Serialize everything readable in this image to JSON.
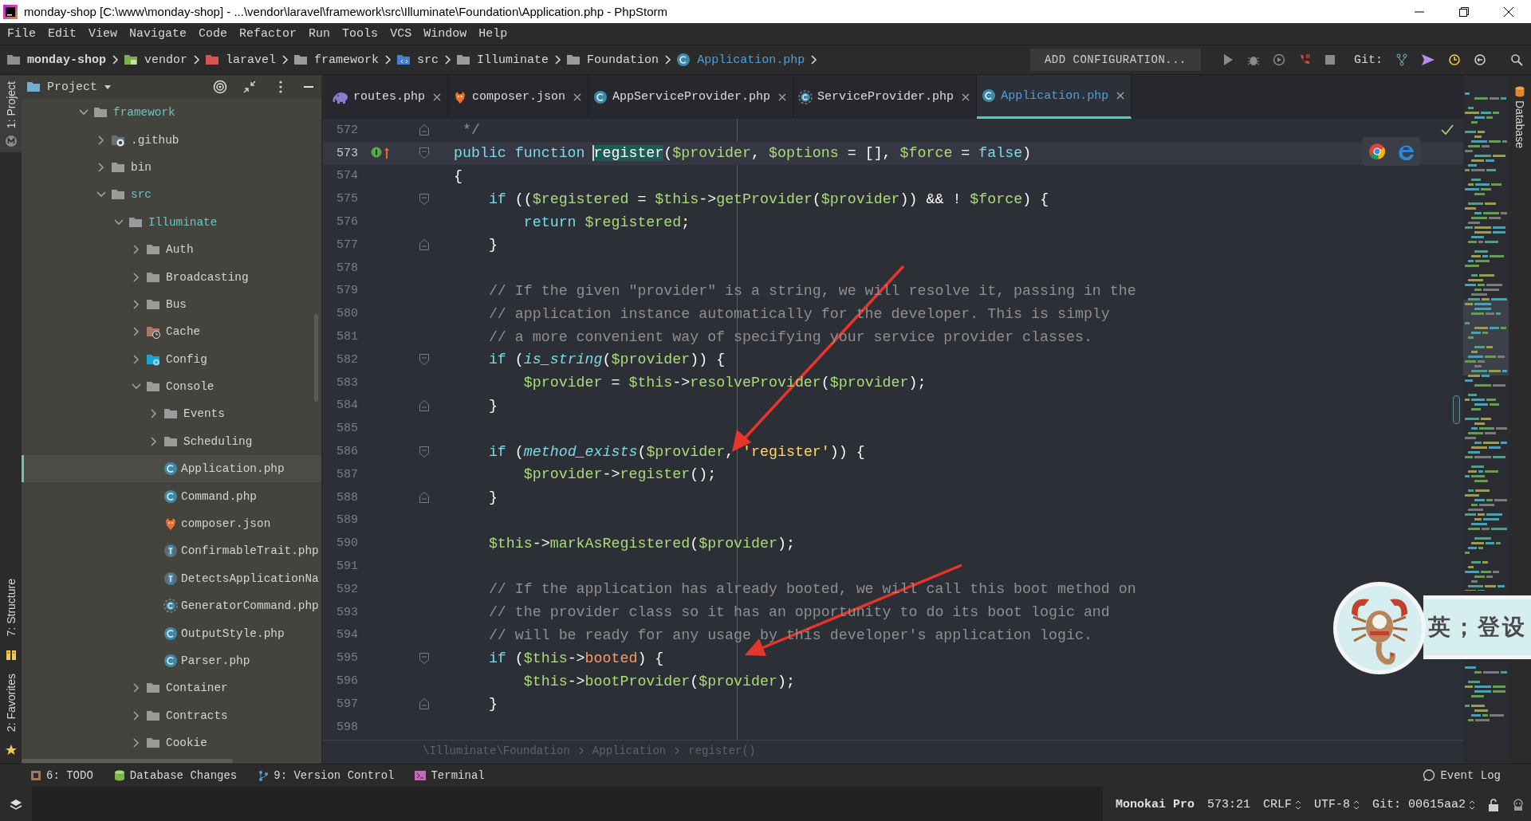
{
  "window": {
    "title": "monday-shop [C:\\www\\monday-shop] - ...\\vendor\\laravel\\framework\\src\\Illuminate\\Foundation\\Application.php - PhpStorm"
  },
  "menu": [
    "File",
    "Edit",
    "View",
    "Navigate",
    "Code",
    "Refactor",
    "Run",
    "Tools",
    "VCS",
    "Window",
    "Help"
  ],
  "navigation": {
    "path": [
      {
        "label": "monday-shop",
        "kind": "project"
      },
      {
        "label": "vendor",
        "kind": "vendor"
      },
      {
        "label": "laravel",
        "kind": "excluded"
      },
      {
        "label": "framework",
        "kind": "folder"
      },
      {
        "label": "src",
        "kind": "source"
      },
      {
        "label": "Illuminate",
        "kind": "folder"
      },
      {
        "label": "Foundation",
        "kind": "folder"
      },
      {
        "label": "Application.php",
        "kind": "class"
      }
    ],
    "run_configuration": "ADD CONFIGURATION...",
    "git_label": "Git:"
  },
  "left_strip": {
    "top": [
      "1: Project"
    ],
    "bottom": [
      "7: Structure",
      "2: Favorites"
    ]
  },
  "right_strip": [
    "Database"
  ],
  "project_panel": {
    "title": "Project",
    "tree": [
      {
        "label": "framework",
        "kind": "folder",
        "expanded": true,
        "selected": false,
        "color": "#6dc5c2",
        "children": [
          {
            "label": ".github",
            "kind": "github",
            "expanded": false,
            "selected": false,
            "color": "#d4d4d4"
          },
          {
            "label": "bin",
            "kind": "folder",
            "expanded": false,
            "selected": false,
            "color": "#d4d4d4"
          },
          {
            "label": "src",
            "kind": "folder",
            "expanded": true,
            "selected": false,
            "color": "#6dc5c2",
            "children": [
              {
                "label": "Illuminate",
                "kind": "folder",
                "expanded": true,
                "selected": false,
                "color": "#6dc5c2",
                "children": [
                  {
                    "label": "Auth",
                    "kind": "folder",
                    "expanded": false,
                    "selected": false,
                    "color": "#d4d4d4"
                  },
                  {
                    "label": "Broadcasting",
                    "kind": "folder",
                    "expanded": false,
                    "selected": false,
                    "color": "#d4d4d4"
                  },
                  {
                    "label": "Bus",
                    "kind": "folder",
                    "expanded": false,
                    "selected": false,
                    "color": "#d4d4d4"
                  },
                  {
                    "label": "Cache",
                    "kind": "cache",
                    "expanded": false,
                    "selected": false,
                    "color": "#d4d4d4"
                  },
                  {
                    "label": "Config",
                    "kind": "config",
                    "expanded": false,
                    "selected": false,
                    "color": "#d4d4d4"
                  },
                  {
                    "label": "Console",
                    "kind": "folder",
                    "expanded": true,
                    "selected": false,
                    "color": "#d4d4d4",
                    "children": [
                      {
                        "label": "Events",
                        "kind": "folder",
                        "expanded": false,
                        "selected": false,
                        "color": "#d4d4d4"
                      },
                      {
                        "label": "Scheduling",
                        "kind": "folder",
                        "expanded": false,
                        "selected": false,
                        "color": "#d4d4d4"
                      },
                      {
                        "label": "Application.php",
                        "kind": "class",
                        "selected": true,
                        "color": "#d4d4d4"
                      },
                      {
                        "label": "Command.php",
                        "kind": "class",
                        "selected": false,
                        "color": "#d4d4d4"
                      },
                      {
                        "label": "composer.json",
                        "kind": "json",
                        "selected": false,
                        "color": "#d4d4d4"
                      },
                      {
                        "label": "ConfirmableTrait.php",
                        "kind": "trait",
                        "selected": false,
                        "color": "#d4d4d4"
                      },
                      {
                        "label": "DetectsApplicationNa",
                        "kind": "trait",
                        "selected": false,
                        "color": "#d4d4d4"
                      },
                      {
                        "label": "GeneratorCommand.php",
                        "kind": "abstract",
                        "selected": false,
                        "color": "#d4d4d4"
                      },
                      {
                        "label": "OutputStyle.php",
                        "kind": "class",
                        "selected": false,
                        "color": "#d4d4d4"
                      },
                      {
                        "label": "Parser.php",
                        "kind": "class",
                        "selected": false,
                        "color": "#d4d4d4"
                      }
                    ]
                  },
                  {
                    "label": "Container",
                    "kind": "folder",
                    "expanded": false,
                    "selected": false,
                    "color": "#d4d4d4"
                  },
                  {
                    "label": "Contracts",
                    "kind": "folder",
                    "expanded": false,
                    "selected": false,
                    "color": "#d4d4d4"
                  },
                  {
                    "label": "Cookie",
                    "kind": "folder",
                    "expanded": false,
                    "selected": false,
                    "color": "#d4d4d4"
                  }
                ]
              }
            ]
          }
        ]
      }
    ]
  },
  "tabs": [
    {
      "label": "routes.php",
      "kind": "php",
      "selected": false
    },
    {
      "label": "composer.json",
      "kind": "json",
      "selected": false
    },
    {
      "label": "AppServiceProvider.php",
      "kind": "class",
      "selected": false
    },
    {
      "label": "ServiceProvider.php",
      "kind": "abstract",
      "selected": false
    },
    {
      "label": "Application.php",
      "kind": "class",
      "selected": true
    }
  ],
  "editor": {
    "lines": [
      {
        "number": "572",
        "current": false,
        "fold_open": false,
        "fold_close": true,
        "implemented": false,
        "tokens": [
          {
            "text": " */",
            "kind": "comment"
          }
        ]
      },
      {
        "number": "573",
        "current": true,
        "fold_open": true,
        "fold_close": false,
        "implemented": true,
        "tokens": [
          {
            "text": "public function ",
            "kind": "keyword"
          },
          {
            "text": "register",
            "kind": "match"
          },
          {
            "text": "(",
            "kind": "plain"
          },
          {
            "text": "$provider",
            "kind": "variable"
          },
          {
            "text": ", ",
            "kind": "plain"
          },
          {
            "text": "$options",
            "kind": "variable"
          },
          {
            "text": " = [], ",
            "kind": "plain"
          },
          {
            "text": "$force",
            "kind": "variable"
          },
          {
            "text": " = ",
            "kind": "plain"
          },
          {
            "text": "false",
            "kind": "keyword"
          },
          {
            "text": ")",
            "kind": "plain"
          }
        ]
      },
      {
        "number": "574",
        "current": false,
        "fold_open": false,
        "fold_close": false,
        "implemented": false,
        "tokens": [
          {
            "text": "{",
            "kind": "plain"
          }
        ]
      },
      {
        "number": "575",
        "current": false,
        "fold_open": true,
        "fold_close": false,
        "implemented": false,
        "tokens": [
          {
            "text": "    if",
            "kind": "keyword"
          },
          {
            "text": " ((",
            "kind": "plain"
          },
          {
            "text": "$registered",
            "kind": "variable"
          },
          {
            "text": " = ",
            "kind": "plain"
          },
          {
            "text": "$this",
            "kind": "variable"
          },
          {
            "text": "->",
            "kind": "plain"
          },
          {
            "text": "getProvider",
            "kind": "method"
          },
          {
            "text": "(",
            "kind": "plain"
          },
          {
            "text": "$provider",
            "kind": "variable"
          },
          {
            "text": ")) && ! ",
            "kind": "plain"
          },
          {
            "text": "$force",
            "kind": "variable"
          },
          {
            "text": ") {",
            "kind": "plain"
          }
        ]
      },
      {
        "number": "576",
        "current": false,
        "fold_open": false,
        "fold_close": false,
        "implemented": false,
        "tokens": [
          {
            "text": "        return ",
            "kind": "keyword"
          },
          {
            "text": "$registered",
            "kind": "variable"
          },
          {
            "text": ";",
            "kind": "plain"
          }
        ]
      },
      {
        "number": "577",
        "current": false,
        "fold_open": false,
        "fold_close": true,
        "implemented": false,
        "tokens": [
          {
            "text": "    }",
            "kind": "plain"
          }
        ]
      },
      {
        "number": "578",
        "current": false,
        "fold_open": false,
        "fold_close": false,
        "implemented": false
      },
      {
        "number": "579",
        "current": false,
        "fold_open": false,
        "fold_close": false,
        "implemented": false,
        "tokens": [
          {
            "text": "    // If the given \"provider\" is a string, we will resolve it, passing in the",
            "kind": "comment"
          }
        ]
      },
      {
        "number": "580",
        "current": false,
        "fold_open": false,
        "fold_close": false,
        "implemented": false,
        "tokens": [
          {
            "text": "    // application instance automatically for the developer. This is simply",
            "kind": "comment"
          }
        ]
      },
      {
        "number": "581",
        "current": false,
        "fold_open": false,
        "fold_close": false,
        "implemented": false,
        "tokens": [
          {
            "text": "    // a more convenient way of specifying your service provider classes.",
            "kind": "comment"
          }
        ]
      },
      {
        "number": "582",
        "current": false,
        "fold_open": true,
        "fold_close": false,
        "implemented": false,
        "tokens": [
          {
            "text": "    if",
            "kind": "keyword"
          },
          {
            "text": " (",
            "kind": "plain"
          },
          {
            "text": "is_string",
            "kind": "builtin"
          },
          {
            "text": "(",
            "kind": "plain"
          },
          {
            "text": "$provider",
            "kind": "variable"
          },
          {
            "text": ")) {",
            "kind": "plain"
          }
        ]
      },
      {
        "number": "583",
        "current": false,
        "fold_open": false,
        "fold_close": false,
        "implemented": false,
        "tokens": [
          {
            "text": "        $provider",
            "kind": "variable"
          },
          {
            "text": " = ",
            "kind": "plain"
          },
          {
            "text": "$this",
            "kind": "variable"
          },
          {
            "text": "->",
            "kind": "plain"
          },
          {
            "text": "resolveProvider",
            "kind": "method"
          },
          {
            "text": "(",
            "kind": "plain"
          },
          {
            "text": "$provider",
            "kind": "variable"
          },
          {
            "text": ");",
            "kind": "plain"
          }
        ]
      },
      {
        "number": "584",
        "current": false,
        "fold_open": false,
        "fold_close": true,
        "implemented": false,
        "tokens": [
          {
            "text": "    }",
            "kind": "plain"
          }
        ]
      },
      {
        "number": "585",
        "current": false,
        "fold_open": false,
        "fold_close": false,
        "implemented": false
      },
      {
        "number": "586",
        "current": false,
        "fold_open": true,
        "fold_close": false,
        "implemented": false,
        "tokens": [
          {
            "text": "    if",
            "kind": "keyword"
          },
          {
            "text": " (",
            "kind": "plain"
          },
          {
            "text": "method_exists",
            "kind": "builtin"
          },
          {
            "text": "(",
            "kind": "plain"
          },
          {
            "text": "$provider",
            "kind": "variable"
          },
          {
            "text": ", ",
            "kind": "plain"
          },
          {
            "text": "'register'",
            "kind": "string"
          },
          {
            "text": ")) {",
            "kind": "plain"
          }
        ]
      },
      {
        "number": "587",
        "current": false,
        "fold_open": false,
        "fold_close": false,
        "implemented": false,
        "tokens": [
          {
            "text": "        $provider",
            "kind": "variable"
          },
          {
            "text": "->",
            "kind": "plain"
          },
          {
            "text": "register",
            "kind": "method"
          },
          {
            "text": "();",
            "kind": "plain"
          }
        ]
      },
      {
        "number": "588",
        "current": false,
        "fold_open": false,
        "fold_close": true,
        "implemented": false,
        "tokens": [
          {
            "text": "    }",
            "kind": "plain"
          }
        ]
      },
      {
        "number": "589",
        "current": false,
        "fold_open": false,
        "fold_close": false,
        "implemented": false
      },
      {
        "number": "590",
        "current": false,
        "fold_open": false,
        "fold_close": false,
        "implemented": false,
        "tokens": [
          {
            "text": "    $this",
            "kind": "variable"
          },
          {
            "text": "->",
            "kind": "plain"
          },
          {
            "text": "markAsRegistered",
            "kind": "method"
          },
          {
            "text": "(",
            "kind": "plain"
          },
          {
            "text": "$provider",
            "kind": "variable"
          },
          {
            "text": ");",
            "kind": "plain"
          }
        ]
      },
      {
        "number": "591",
        "current": false,
        "fold_open": false,
        "fold_close": false,
        "implemented": false
      },
      {
        "number": "592",
        "current": false,
        "fold_open": false,
        "fold_close": false,
        "implemented": false,
        "tokens": [
          {
            "text": "    // If the application has already booted, we will call this boot method on",
            "kind": "comment"
          }
        ]
      },
      {
        "number": "593",
        "current": false,
        "fold_open": false,
        "fold_close": false,
        "implemented": false,
        "tokens": [
          {
            "text": "    // the provider class so it has an opportunity to do its boot logic and",
            "kind": "comment"
          }
        ]
      },
      {
        "number": "594",
        "current": false,
        "fold_open": false,
        "fold_close": false,
        "implemented": false,
        "tokens": [
          {
            "text": "    // will be ready for any usage by this developer's application logic.",
            "kind": "comment"
          }
        ]
      },
      {
        "number": "595",
        "current": false,
        "fold_open": true,
        "fold_close": false,
        "implemented": false,
        "tokens": [
          {
            "text": "    if",
            "kind": "keyword"
          },
          {
            "text": " (",
            "kind": "plain"
          },
          {
            "text": "$this",
            "kind": "variable"
          },
          {
            "text": "->",
            "kind": "plain"
          },
          {
            "text": "booted",
            "kind": "property"
          },
          {
            "text": ") {",
            "kind": "plain"
          }
        ]
      },
      {
        "number": "596",
        "current": false,
        "fold_open": false,
        "fold_close": false,
        "implemented": false,
        "tokens": [
          {
            "text": "        $this",
            "kind": "variable"
          },
          {
            "text": "->",
            "kind": "plain"
          },
          {
            "text": "bootProvider",
            "kind": "method"
          },
          {
            "text": "(",
            "kind": "plain"
          },
          {
            "text": "$provider",
            "kind": "variable"
          },
          {
            "text": ");",
            "kind": "plain"
          }
        ]
      },
      {
        "number": "597",
        "current": false,
        "fold_open": false,
        "fold_close": true,
        "implemented": false,
        "tokens": [
          {
            "text": "    }",
            "kind": "plain"
          }
        ]
      },
      {
        "number": "598",
        "current": false,
        "fold_open": false,
        "fold_close": false,
        "implemented": false
      }
    ],
    "breadcrumb": [
      "\\Illuminate\\Foundation",
      "Application",
      "register()"
    ]
  },
  "tool_windows": [
    {
      "label": "6: TODO",
      "kind": "todo"
    },
    {
      "label": "Database Changes",
      "kind": "database"
    },
    {
      "label": "9: Version Control",
      "kind": "branch"
    },
    {
      "label": "Terminal",
      "kind": "terminal"
    }
  ],
  "event_log": "Event Log",
  "status_bar": {
    "theme": "Monokai Pro",
    "position": "573:21",
    "line_separator": "CRLF",
    "encoding": "UTF-8",
    "vcs": "Git: 00615aa2"
  },
  "input_method": {
    "keys": [
      "英",
      "；",
      "登",
      "设"
    ]
  }
}
